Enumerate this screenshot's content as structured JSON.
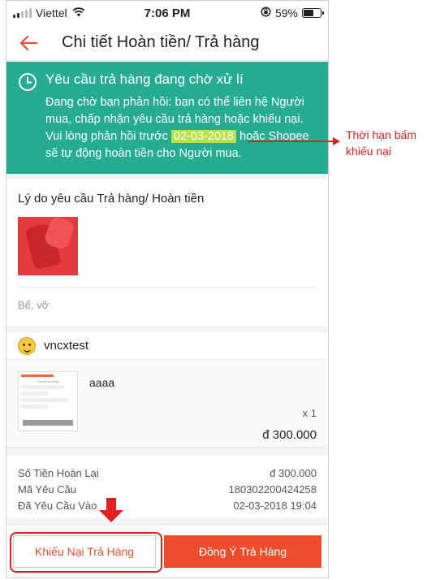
{
  "status_bar": {
    "carrier": "Viettel",
    "time": "7:06 PM",
    "battery": "59%",
    "battery_level": 0.59
  },
  "nav": {
    "title": "Chi tiết Hoàn tiền/ Trả hàng",
    "back_icon": "arrow-left-icon",
    "accent_color": "#ee4d2d"
  },
  "banner": {
    "color": "#26ad91",
    "title": "Yêu cầu trả hàng đang chờ xử lí",
    "body_before": "Đang chờ bạn phản hồi: bạn có thể liên hệ Người mua, chấp nhận yêu cầu trả hàng hoặc khiếu nại. Vui lòng phản hồi trước",
    "deadline": "02-03-2018",
    "body_after": "hoặc Shopee sẽ tự động hoàn tiền cho Người mua."
  },
  "reason": {
    "title": "Lý do yêu cầu Trả hàng/ Hoàn tiền",
    "note": "Bể, vỡ"
  },
  "buyer": {
    "name": "vncxtest"
  },
  "product": {
    "name": "aaaa",
    "quantity": "x 1",
    "price": "đ 300.000",
    "thumb_title": "Chuẩn bị hàng"
  },
  "summary": {
    "rows": [
      {
        "label": "Số Tiền Hoàn Lại",
        "value": "đ 300.000"
      },
      {
        "label": "Mã Yêu Cầu",
        "value": "180302200424258"
      },
      {
        "label": "Đã Yêu Cầu Vào",
        "value": "02-03-2018 19:04"
      }
    ]
  },
  "footer": {
    "complain_label": "Khiếu Nại Trả Hàng",
    "accept_label": "Đồng Ý Trả Hàng"
  },
  "annotation": {
    "callout": "Thời hạn bấm khiếu nại",
    "color": "#e02020"
  }
}
